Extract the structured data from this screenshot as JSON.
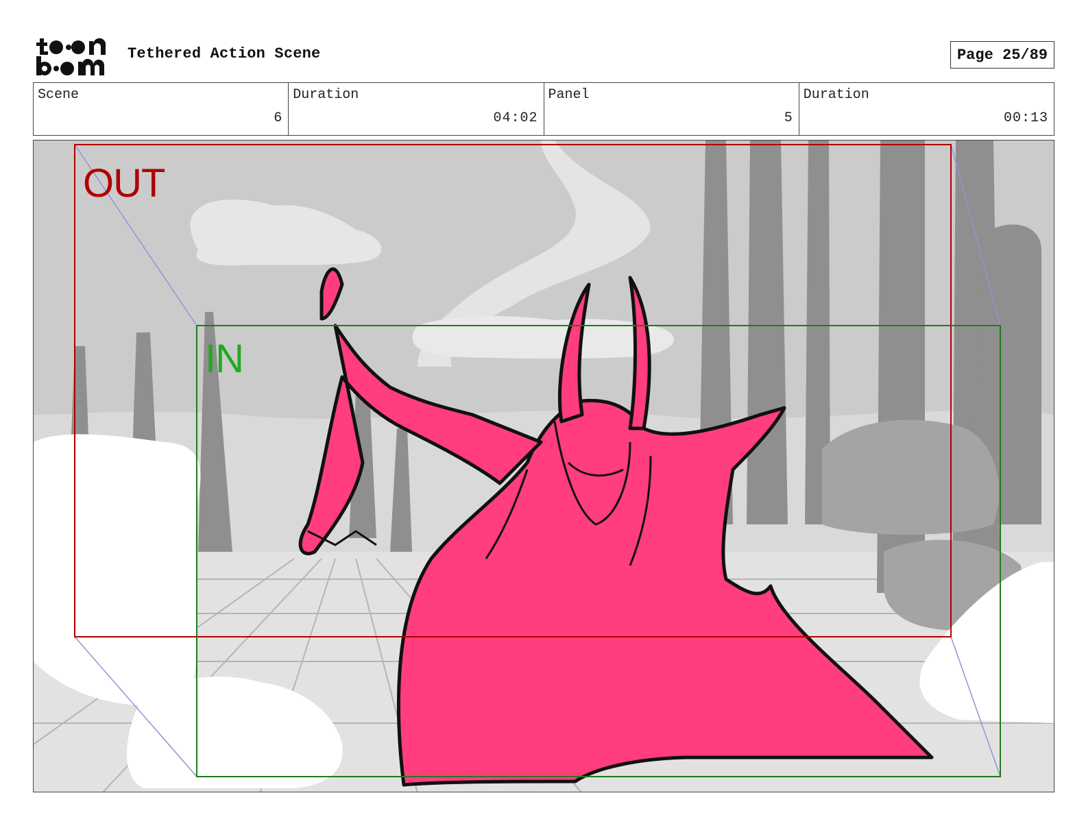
{
  "header": {
    "logo_text": "toonboom",
    "title": "Tethered Action Scene",
    "page": "Page 25/89"
  },
  "info": {
    "scene_label": "Scene",
    "scene_value": "6",
    "scene_duration_label": "Duration",
    "scene_duration_value": "04:02",
    "panel_label": "Panel",
    "panel_value": "5",
    "panel_duration_label": "Duration",
    "panel_duration_value": "00:13"
  },
  "panel": {
    "out_label": "OUT",
    "in_label": "IN",
    "colors": {
      "out_frame": "#b00000",
      "in_frame": "#1f7a1f",
      "character_fill": "#ff3d7f",
      "background_gray": "#c8c8c8"
    }
  }
}
